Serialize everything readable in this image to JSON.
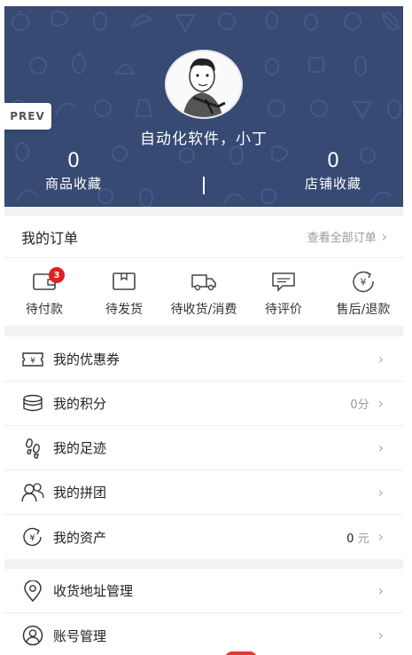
{
  "header": {
    "username": "自动化软件，小丁",
    "bg_color": "#364a74",
    "stats": [
      {
        "value": "0",
        "label": "商品收藏"
      },
      {
        "value": "0",
        "label": "店铺收藏"
      }
    ]
  },
  "prev_button": "PREV",
  "orders": {
    "title": "我的订单",
    "view_all": "查看全部订单",
    "items": [
      {
        "label": "待付款",
        "icon": "wallet-icon",
        "badge": "3"
      },
      {
        "label": "待发货",
        "icon": "package-icon"
      },
      {
        "label": "待收货/消费",
        "icon": "truck-icon"
      },
      {
        "label": "待评价",
        "icon": "comment-icon"
      },
      {
        "label": "售后/退款",
        "icon": "refund-icon"
      }
    ]
  },
  "menu1": [
    {
      "label": "我的优惠券",
      "icon": "coupon-icon"
    },
    {
      "label": "我的积分",
      "icon": "points-icon",
      "value": "0分"
    },
    {
      "label": "我的足迹",
      "icon": "footprint-icon"
    },
    {
      "label": "我的拼团",
      "icon": "group-icon"
    },
    {
      "label": "我的资产",
      "icon": "assets-icon",
      "value_num": "0",
      "value_unit": "元"
    }
  ],
  "menu2": [
    {
      "label": "收货地址管理",
      "icon": "location-icon"
    },
    {
      "label": "账号管理",
      "icon": "account-icon"
    }
  ],
  "colors": {
    "badge": "#e02020",
    "gap": "#f2f2f2"
  }
}
